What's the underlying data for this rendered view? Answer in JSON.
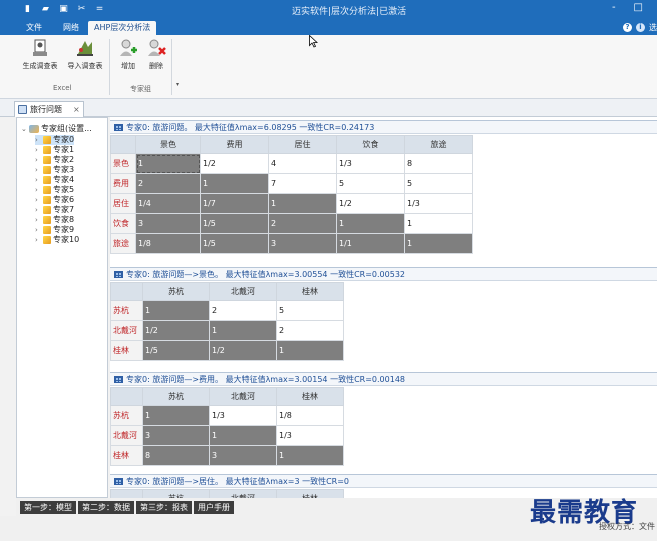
{
  "titlebar": {
    "title": "迈实软件|层次分析法|已激活",
    "qa_icons": [
      "new-file-icon",
      "open-folder-icon",
      "save-icon",
      "tools-icon",
      "dropdown-icon"
    ],
    "winctl": [
      "-",
      "□"
    ]
  },
  "ribbon_tabs": [
    {
      "label": "文件",
      "active": false
    },
    {
      "label": "网络",
      "active": false
    },
    {
      "label": "AHP层次分析法",
      "active": true
    }
  ],
  "tabright": {
    "help": "?",
    "info": "i",
    "trailing": "选"
  },
  "ribbon": {
    "buttons": [
      {
        "label": "生成调查表",
        "icon": "survey-generate-icon"
      },
      {
        "label": "导入调查表",
        "icon": "survey-import-icon"
      },
      {
        "label": "增加",
        "icon": "add-expert-icon"
      },
      {
        "label": "删除",
        "icon": "remove-expert-icon"
      }
    ],
    "groups": [
      {
        "label": "Excel"
      },
      {
        "label": "专家组"
      }
    ]
  },
  "doc_tab": {
    "label": "旅行问题",
    "close": "×"
  },
  "tree": {
    "root": "专家组(设置...",
    "items": [
      "专家0",
      "专家1",
      "专家2",
      "专家3",
      "专家4",
      "专家5",
      "专家6",
      "专家7",
      "专家8",
      "专家9",
      "专家10"
    ],
    "selected": 0
  },
  "blocks": [
    {
      "header": "专家0: 旅游问题。 最大特征值λmax=6.08295 一致性CR=0.24173",
      "columns": [
        "",
        "景色",
        "费用",
        "居住",
        "饮食",
        "旅途"
      ],
      "rows": [
        {
          "h": "景色",
          "v": [
            "1",
            "1/2",
            "4",
            "1/3",
            "8"
          ]
        },
        {
          "h": "费用",
          "v": [
            "2",
            "1",
            "7",
            "5",
            "5"
          ]
        },
        {
          "h": "居住",
          "v": [
            "1/4",
            "1/7",
            "1",
            "1/2",
            "1/3"
          ]
        },
        {
          "h": "饮食",
          "v": [
            "3",
            "1/5",
            "2",
            "1",
            "1"
          ]
        },
        {
          "h": "旅途",
          "v": [
            "1/8",
            "1/5",
            "3",
            "1/1",
            "1"
          ]
        }
      ]
    },
    {
      "header": "专家0: 旅游问题—>景色。 最大特征值λmax=3.00554 一致性CR=0.00532",
      "columns": [
        "",
        "苏杭",
        "北戴河",
        "桂林"
      ],
      "rows": [
        {
          "h": "苏杭",
          "v": [
            "1",
            "2",
            "5"
          ]
        },
        {
          "h": "北戴河",
          "v": [
            "1/2",
            "1",
            "2"
          ]
        },
        {
          "h": "桂林",
          "v": [
            "1/5",
            "1/2",
            "1"
          ]
        }
      ]
    },
    {
      "header": "专家0: 旅游问题—>费用。 最大特征值λmax=3.00154 一致性CR=0.00148",
      "columns": [
        "",
        "苏杭",
        "北戴河",
        "桂林"
      ],
      "rows": [
        {
          "h": "苏杭",
          "v": [
            "1",
            "1/3",
            "1/8"
          ]
        },
        {
          "h": "北戴河",
          "v": [
            "3",
            "1",
            "1/3"
          ]
        },
        {
          "h": "桂林",
          "v": [
            "8",
            "3",
            "1"
          ]
        }
      ]
    },
    {
      "header": "专家0: 旅游问题—>居住。 最大特征值λmax=3 一致性CR=0",
      "columns": [
        "",
        "苏杭",
        "北戴河",
        "桂林"
      ],
      "rows": []
    }
  ],
  "steps": [
    "第一步：模型",
    "第二步：数据",
    "第三步：报表",
    "用户手册"
  ],
  "status": {
    "auth": "授权方式：文件"
  },
  "watermark": "最需教育",
  "colors": {
    "titlebar": "#1f6dbb",
    "row_header_text": "#c0282b",
    "dark_cell": "#7f7f7f",
    "header_text": "#1f4f96"
  }
}
